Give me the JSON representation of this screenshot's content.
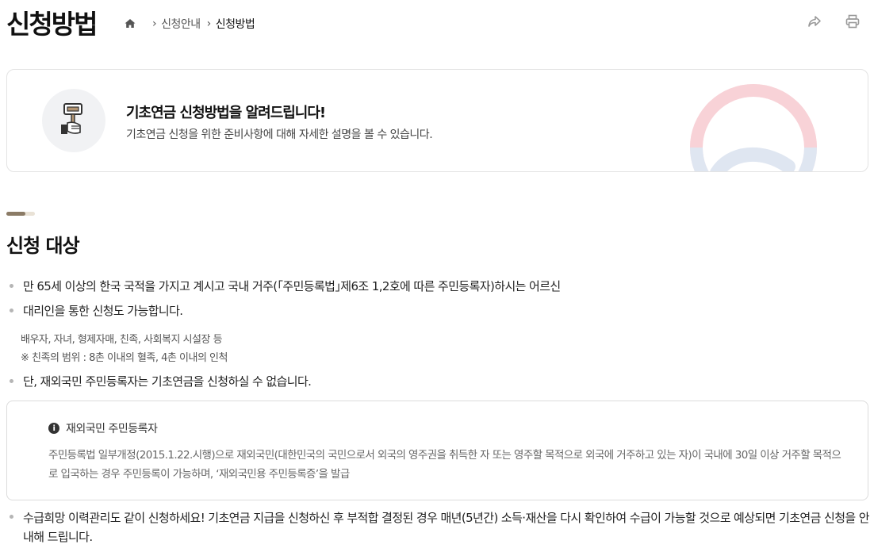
{
  "header": {
    "title": "신청방법",
    "breadcrumb": [
      "신청안내",
      "신청방법"
    ]
  },
  "icons": {
    "home": "home-icon",
    "share": "share-icon",
    "print": "print-icon"
  },
  "intro": {
    "title": "기초연금 신청방법을 알려드립니다!",
    "description": "기초연금 신청을 위한 준비사항에 대해 자세한 설명을 볼 수 있습니다."
  },
  "section": {
    "title": "신청 대상",
    "bullets": [
      "만 65세 이상의 한국 국적을 가지고 계시고 국내 거주(｢주민등록법｣제6조 1,2호에 따른 주민등록자)하시는 어르신",
      "대리인을 통한 신청도 가능합니다.",
      "단, 재외국민 주민등록자는 기초연금을 신청하실 수 없습니다.",
      "수급희망 이력관리도 같이 신청하세요! 기초연금 지급을 신청하신 후 부적합 결정된 경우 매년(5년간) 소득·재산을 다시 확인하여 수급이 가능할 것으로 예상되면 기초연금 신청을 안내해 드립니다."
    ],
    "proxy_sub": [
      "배우자, 자녀, 형제자매, 친족, 사회복지 시설장 등",
      "※ 친족의 범위 : 8촌 이내의 혈족, 4촌 이내의 인척"
    ],
    "notice": {
      "title": "재외국민 주민등록자",
      "body": "주민등록법 일부개정(2015.1.22.시행)으로 재외국민(대한민국의 국민으로서 외국의 영주권을 취득한 자 또는 영주할 목적으로 외국에 거주하고 있는 자)이 국내에 30일 이상 거주할 목적으로 입국하는 경우 주민등록이 가능하며, ‘재외국민용 주민등록증’을 발급"
    }
  },
  "colors": {
    "accent": "#8b7b66",
    "deco_red": "#e04b5a",
    "deco_blue": "#3f63a6"
  }
}
